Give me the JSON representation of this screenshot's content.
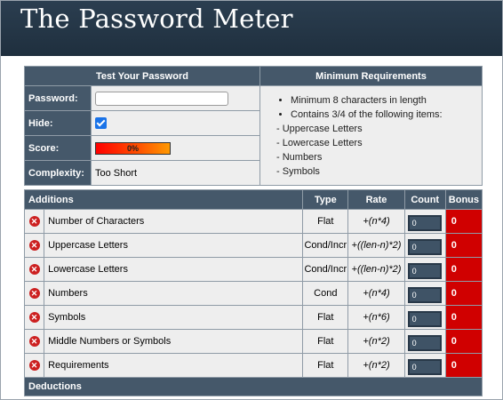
{
  "header": {
    "title": "The Password Meter"
  },
  "test": {
    "heading": "Test Your Password",
    "password_label": "Password:",
    "password_value": "",
    "hide_label": "Hide:",
    "hide_checked": true,
    "score_label": "Score:",
    "score_value": "0%",
    "complexity_label": "Complexity:",
    "complexity_value": "Too Short"
  },
  "requirements": {
    "heading": "Minimum Requirements",
    "items": [
      "Minimum 8 characters in length",
      "Contains 3/4 of the following items:"
    ],
    "subitems": [
      "- Uppercase Letters",
      "- Lowercase Letters",
      "- Numbers",
      "- Symbols"
    ]
  },
  "additions": {
    "headers": {
      "name": "Additions",
      "type": "Type",
      "rate": "Rate",
      "count": "Count",
      "bonus": "Bonus"
    },
    "rows": [
      {
        "name": "Number of Characters",
        "type": "Flat",
        "rate": "+(n*4)",
        "count": "0",
        "bonus": "0"
      },
      {
        "name": "Uppercase Letters",
        "type": "Cond/Incr",
        "rate": "+((len-n)*2)",
        "count": "0",
        "bonus": "0"
      },
      {
        "name": "Lowercase Letters",
        "type": "Cond/Incr",
        "rate": "+((len-n)*2)",
        "count": "0",
        "bonus": "0"
      },
      {
        "name": "Numbers",
        "type": "Cond",
        "rate": "+(n*4)",
        "count": "0",
        "bonus": "0"
      },
      {
        "name": "Symbols",
        "type": "Flat",
        "rate": "+(n*6)",
        "count": "0",
        "bonus": "0"
      },
      {
        "name": "Middle Numbers or Symbols",
        "type": "Flat",
        "rate": "+(n*2)",
        "count": "0",
        "bonus": "0"
      },
      {
        "name": "Requirements",
        "type": "Flat",
        "rate": "+(n*2)",
        "count": "0",
        "bonus": "0"
      }
    ],
    "status_icon": "x-circle-icon"
  },
  "deductions": {
    "heading": "Deductions"
  },
  "colors": {
    "header_bg": "#233545",
    "table_head": "#45586a",
    "bonus_bad": "#d00000"
  }
}
